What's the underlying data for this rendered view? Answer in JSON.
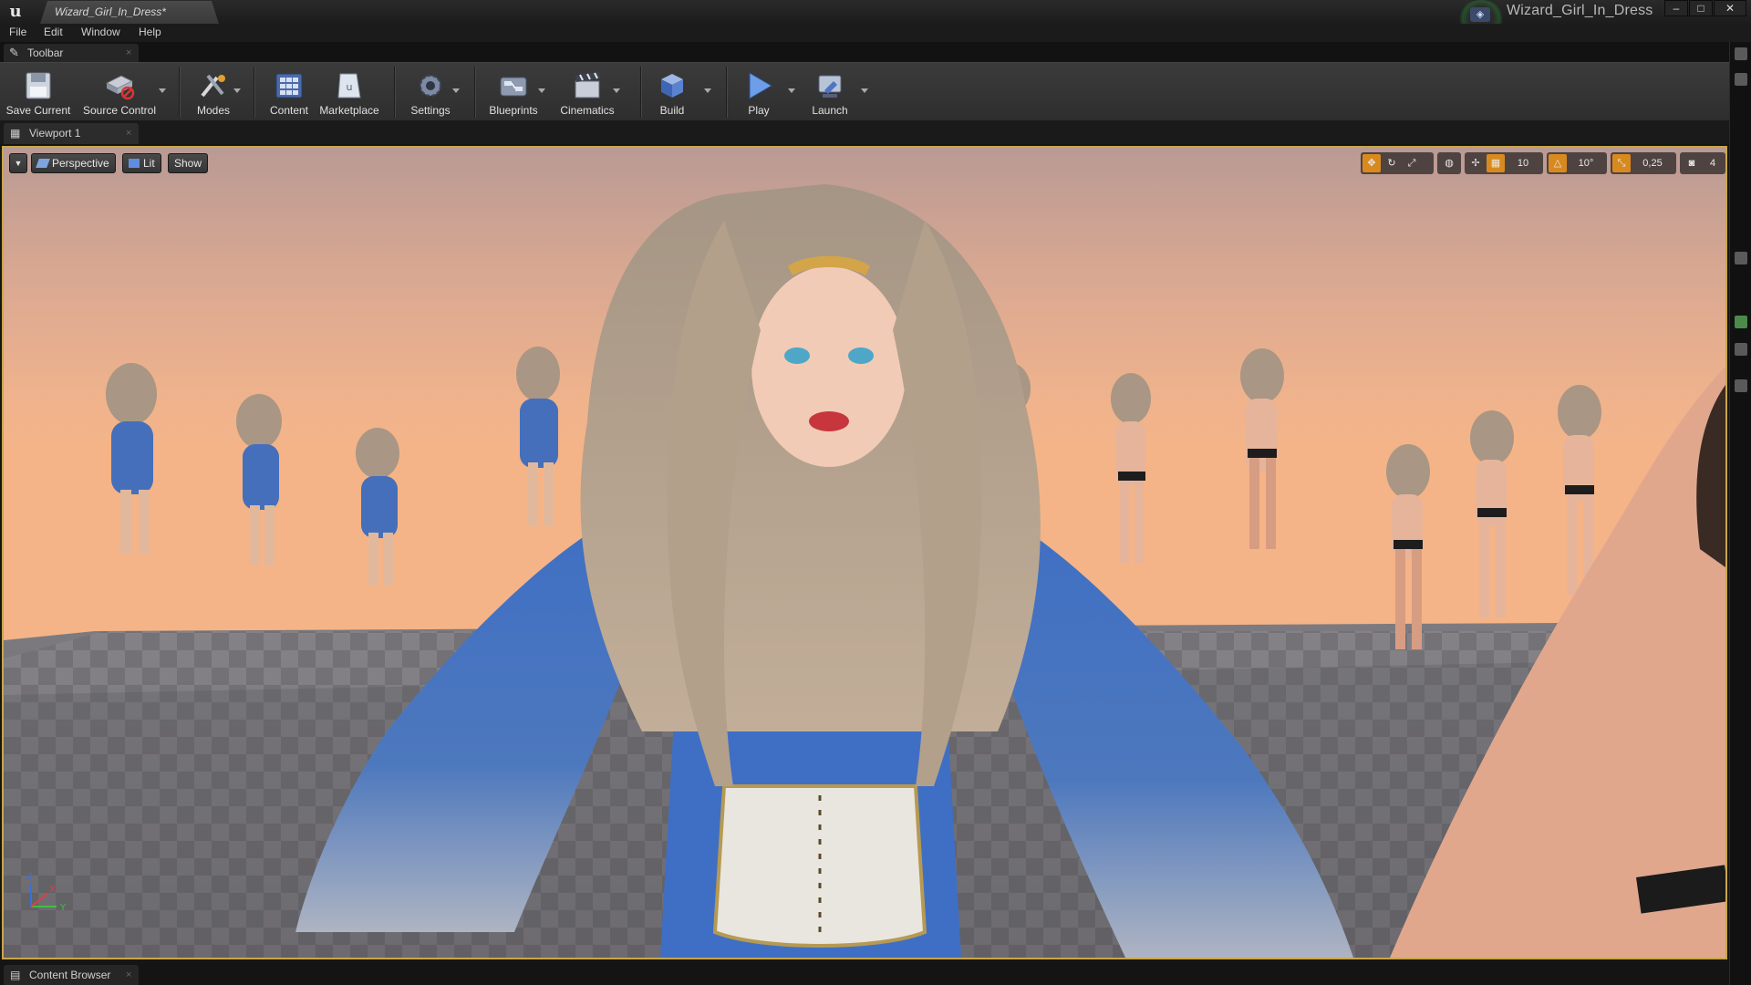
{
  "window": {
    "doc_tab": "Wizard_Girl_In_Dress*",
    "project_name": "Wizard_Girl_In_Dress",
    "buttons": {
      "minimize": "–",
      "maximize": "□",
      "close": "✕"
    }
  },
  "menu": [
    "File",
    "Edit",
    "Window",
    "Help"
  ],
  "toolbar_tab": {
    "label": "Toolbar"
  },
  "toolbar": {
    "save_current": "Save Current",
    "source_control": "Source Control",
    "modes": "Modes",
    "content": "Content",
    "marketplace": "Marketplace",
    "settings": "Settings",
    "blueprints": "Blueprints",
    "cinematics": "Cinematics",
    "build": "Build",
    "play": "Play",
    "launch": "Launch"
  },
  "viewport_tab": {
    "label": "Viewport 1"
  },
  "viewport": {
    "view_mode": "Perspective",
    "lighting": "Lit",
    "show": "Show",
    "grid_snap": "10",
    "rotation_snap": "10°",
    "scale_snap": "0,25",
    "camera_speed": "4",
    "axis_x": "X",
    "axis_y": "Y",
    "axis_z": "Z"
  },
  "bottom_tab": {
    "label": "Content Browser"
  },
  "colors": {
    "accent_orange": "#d88a1f",
    "dress_blue": "#3f6fc4",
    "viewport_border": "#c9a64a"
  }
}
